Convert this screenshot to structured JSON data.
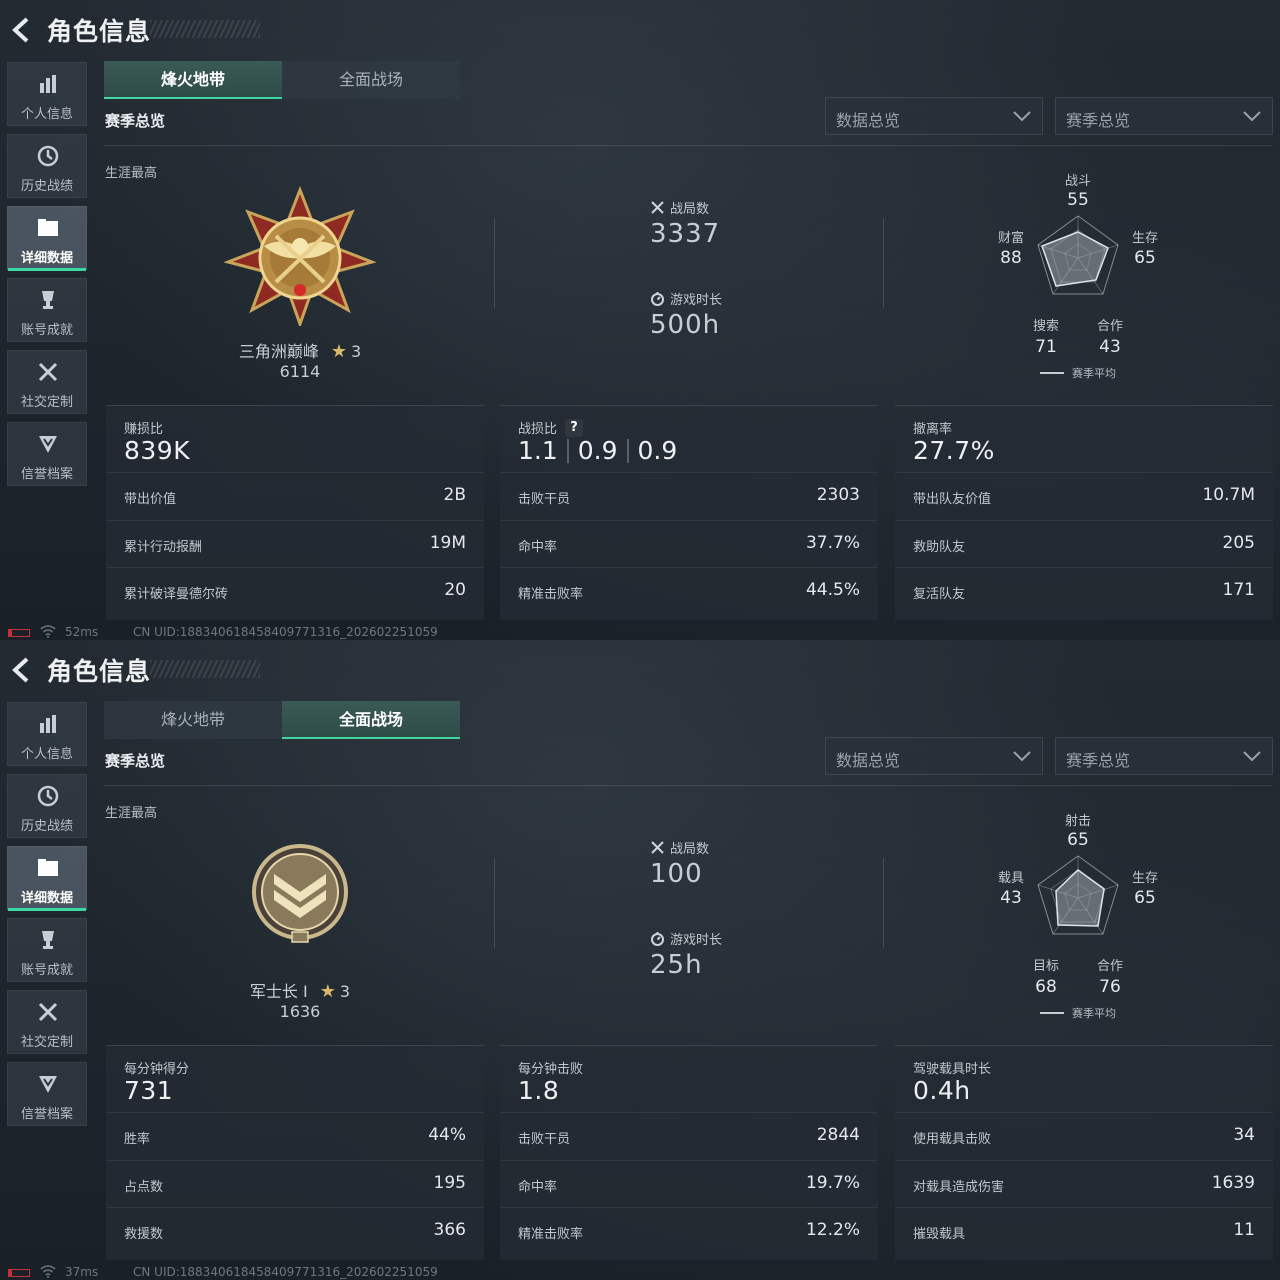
{
  "panels": [
    {
      "title": "角色信息",
      "sidebar": [
        "个人信息",
        "历史战绩",
        "详细数据",
        "账号成就",
        "社交定制",
        "信誉档案"
      ],
      "active_sidebar": 2,
      "mode_tabs": [
        "烽火地带",
        "全面战场"
      ],
      "active_tab": 0,
      "season_heading": "赛季总览",
      "dropdowns": [
        "数据总览",
        "赛季总览"
      ],
      "career_label": "生涯最高",
      "rank": {
        "name": "三角洲巅峰",
        "stars": "3",
        "score": "6114",
        "badge": "medal-eagle-icon"
      },
      "matches": {
        "label": "战局数",
        "value": "3337"
      },
      "playtime": {
        "label": "游戏时长",
        "value": "500h"
      },
      "radar": {
        "top": {
          "label": "战斗",
          "value": "55"
        },
        "right": {
          "label": "生存",
          "value": "65"
        },
        "bottom_right": {
          "label": "合作",
          "value": "43"
        },
        "bottom_left": {
          "label": "搜索",
          "value": "71"
        },
        "left": {
          "label": "财富",
          "value": "88"
        },
        "legend": "赛季平均"
      },
      "cards": [
        {
          "label": "赚损比",
          "value": "839K",
          "rows": [
            {
              "label": "带出价值",
              "value": "2B"
            },
            {
              "label": "累计行动报酬",
              "value": "19M"
            },
            {
              "label": "累计破译曼德尔砖",
              "value": "20"
            }
          ]
        },
        {
          "label": "战损比",
          "help": "?",
          "ratio": [
            "1.1",
            "0.9",
            "0.9"
          ],
          "rows": [
            {
              "label": "击败干员",
              "value": "2303"
            },
            {
              "label": "命中率",
              "value": "37.7%"
            },
            {
              "label": "精准击败率",
              "value": "44.5%"
            }
          ]
        },
        {
          "label": "撤离率",
          "value": "27.7%",
          "rows": [
            {
              "label": "带出队友价值",
              "value": "10.7M"
            },
            {
              "label": "救助队友",
              "value": "205"
            },
            {
              "label": "复活队友",
              "value": "171"
            }
          ]
        }
      ],
      "footer": {
        "ping": "52ms",
        "uid": "CN UID:1883406184584097713​16_202602251059"
      }
    },
    {
      "title": "角色信息",
      "sidebar": [
        "个人信息",
        "历史战绩",
        "详细数据",
        "账号成就",
        "社交定制",
        "信誉档案"
      ],
      "active_sidebar": 2,
      "mode_tabs": [
        "烽火地带",
        "全面战场"
      ],
      "active_tab": 1,
      "season_heading": "赛季总览",
      "dropdowns": [
        "数据总览",
        "赛季总览"
      ],
      "career_label": "生涯最高",
      "rank": {
        "name": "军士长 I",
        "stars": "3",
        "score": "1636",
        "badge": "chevron-rank-icon"
      },
      "matches": {
        "label": "战局数",
        "value": "100"
      },
      "playtime": {
        "label": "游戏时长",
        "value": "25h"
      },
      "radar": {
        "top": {
          "label": "射击",
          "value": "65"
        },
        "right": {
          "label": "生存",
          "value": "65"
        },
        "bottom_right": {
          "label": "合作",
          "value": "76"
        },
        "bottom_left": {
          "label": "目标",
          "value": "68"
        },
        "left": {
          "label": "载具",
          "value": "43"
        },
        "legend": "赛季平均"
      },
      "cards": [
        {
          "label": "每分钟得分",
          "value": "731",
          "rows": [
            {
              "label": "胜率",
              "value": "44%"
            },
            {
              "label": "占点数",
              "value": "195"
            },
            {
              "label": "救援数",
              "value": "366"
            }
          ]
        },
        {
          "label": "每分钟击败",
          "value": "1.8",
          "rows": [
            {
              "label": "击败干员",
              "value": "2844"
            },
            {
              "label": "命中率",
              "value": "19.7%"
            },
            {
              "label": "精准击败率",
              "value": "12.2%"
            }
          ]
        },
        {
          "label": "驾驶载具时长",
          "value": "0.4h",
          "rows": [
            {
              "label": "使用载具击败",
              "value": "34"
            },
            {
              "label": "对载具造成伤害",
              "value": "1639"
            },
            {
              "label": "摧毁载具",
              "value": "11"
            }
          ]
        }
      ],
      "footer": {
        "ping": "37ms",
        "uid": "CN UID:1883406184584097713​16_202602251059"
      }
    }
  ],
  "colors": {
    "accent": "#3fd6a0",
    "battery": "#c5303a",
    "gold": "#d9b869"
  }
}
